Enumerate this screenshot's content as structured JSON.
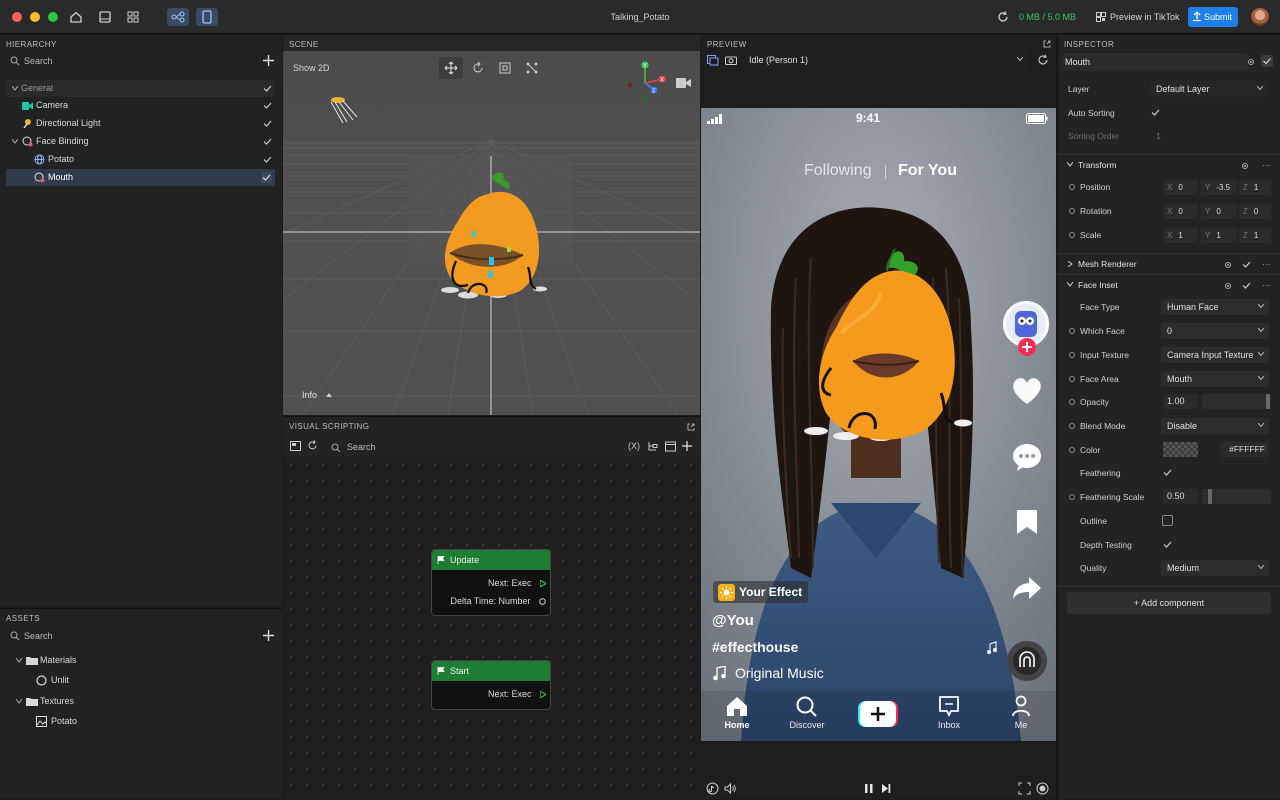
{
  "app": {
    "title": "Talking_Potato",
    "memory": "0 MB / 5.0 MB",
    "preview_tiktok": "Preview in TikTok",
    "submit": "Submit"
  },
  "hierarchy": {
    "title": "HIERARCHY",
    "search_placeholder": "Search",
    "items": [
      {
        "label": "General"
      },
      {
        "label": "Camera"
      },
      {
        "label": "Directional Light"
      },
      {
        "label": "Face Binding"
      },
      {
        "label": "Potato"
      },
      {
        "label": "Mouth"
      }
    ]
  },
  "assets": {
    "title": "ASSETS",
    "search_placeholder": "Search",
    "items": [
      {
        "label": "Materials"
      },
      {
        "label": "Unlit"
      },
      {
        "label": "Textures"
      },
      {
        "label": "Potato"
      }
    ]
  },
  "scene": {
    "title": "SCENE",
    "show2d": "Show 2D",
    "info": "Info"
  },
  "visual_scripting": {
    "title": "VISUAL SCRIPTING",
    "search_placeholder": "Search",
    "var_label": "(X)",
    "nodes": [
      {
        "title": "Update",
        "outputs": [
          "Next: Exec",
          "Delta Time: Number"
        ]
      },
      {
        "title": "Start",
        "outputs": [
          "Next: Exec"
        ]
      }
    ]
  },
  "preview": {
    "title": "PREVIEW",
    "mode": "Idle (Person 1)",
    "phone": {
      "time": "9:41",
      "following": "Following",
      "for_you": "For You",
      "effect": "Your Effect",
      "user": "@You",
      "hashtag": "#effecthouse",
      "music": "Original Music",
      "nav": [
        "Home",
        "Discover",
        "Inbox",
        "Me"
      ]
    }
  },
  "inspector": {
    "title": "INSPECTOR",
    "object_name": "Mouth",
    "layer_label": "Layer",
    "layer_value": "Default Layer",
    "auto_sorting": "Auto Sorting",
    "sorting_order": "Sorting Order",
    "sorting_order_value": "1",
    "transform": {
      "title": "Transform",
      "rows": [
        {
          "label": "Position",
          "x": "0",
          "y": "-3.5",
          "z": "1"
        },
        {
          "label": "Rotation",
          "x": "0",
          "y": "0",
          "z": "0"
        },
        {
          "label": "Scale",
          "x": "1",
          "y": "1",
          "z": "1"
        }
      ]
    },
    "mesh_renderer": "Mesh Renderer",
    "face_inset": {
      "title": "Face Inset",
      "face_type_label": "Face Type",
      "face_type": "Human Face",
      "which_face_label": "Which Face",
      "which_face": "0",
      "input_texture_label": "Input Texture",
      "input_texture": "Camera Input Texture",
      "face_area_label": "Face Area",
      "face_area": "Mouth",
      "opacity_label": "Opacity",
      "opacity": "1.00",
      "blend_mode_label": "Blend Mode",
      "blend_mode": "Disable",
      "color_label": "Color",
      "color_hex": "#FFFFFF",
      "feathering_label": "Feathering",
      "feathering_scale_label": "Feathering Scale",
      "feathering_scale": "0.50",
      "outline_label": "Outline",
      "depth_testing_label": "Depth Testing",
      "quality_label": "Quality",
      "quality": "Medium"
    },
    "add_component": "+ Add component"
  },
  "axis": {
    "x": "X",
    "y": "Y",
    "z": "Z"
  }
}
